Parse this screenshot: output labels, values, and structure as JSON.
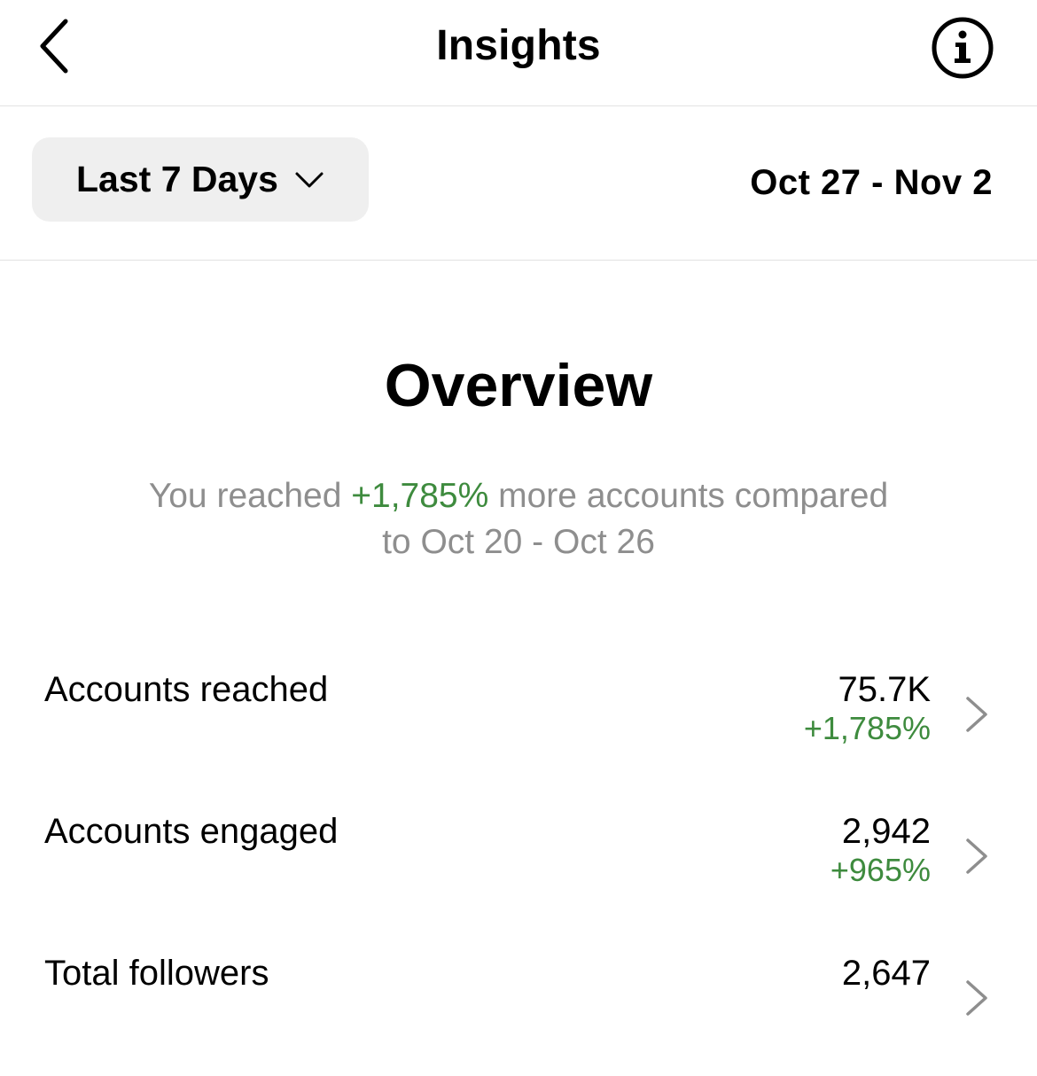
{
  "header": {
    "title": "Insights",
    "back_icon": "chevron-left-icon",
    "info_icon": "info-icon"
  },
  "filter": {
    "selected_range": "Last 7 Days",
    "dropdown_icon": "chevron-down-icon",
    "date_range": "Oct 27 - Nov 2"
  },
  "overview": {
    "title": "Overview",
    "summary_prefix": "You reached ",
    "summary_highlight": "+1,785%",
    "summary_suffix": " more accounts compared",
    "summary_line2": "to Oct 20 - Oct 26"
  },
  "metrics": [
    {
      "label": "Accounts reached",
      "value": "75.7K",
      "change": "+1,785%"
    },
    {
      "label": "Accounts engaged",
      "value": "2,942",
      "change": "+965%"
    },
    {
      "label": "Total followers",
      "value": "2,647",
      "change": ""
    }
  ],
  "colors": {
    "positive": "#3e8b3e",
    "muted_text": "#8e8e8e",
    "pill_background": "#efefef"
  }
}
